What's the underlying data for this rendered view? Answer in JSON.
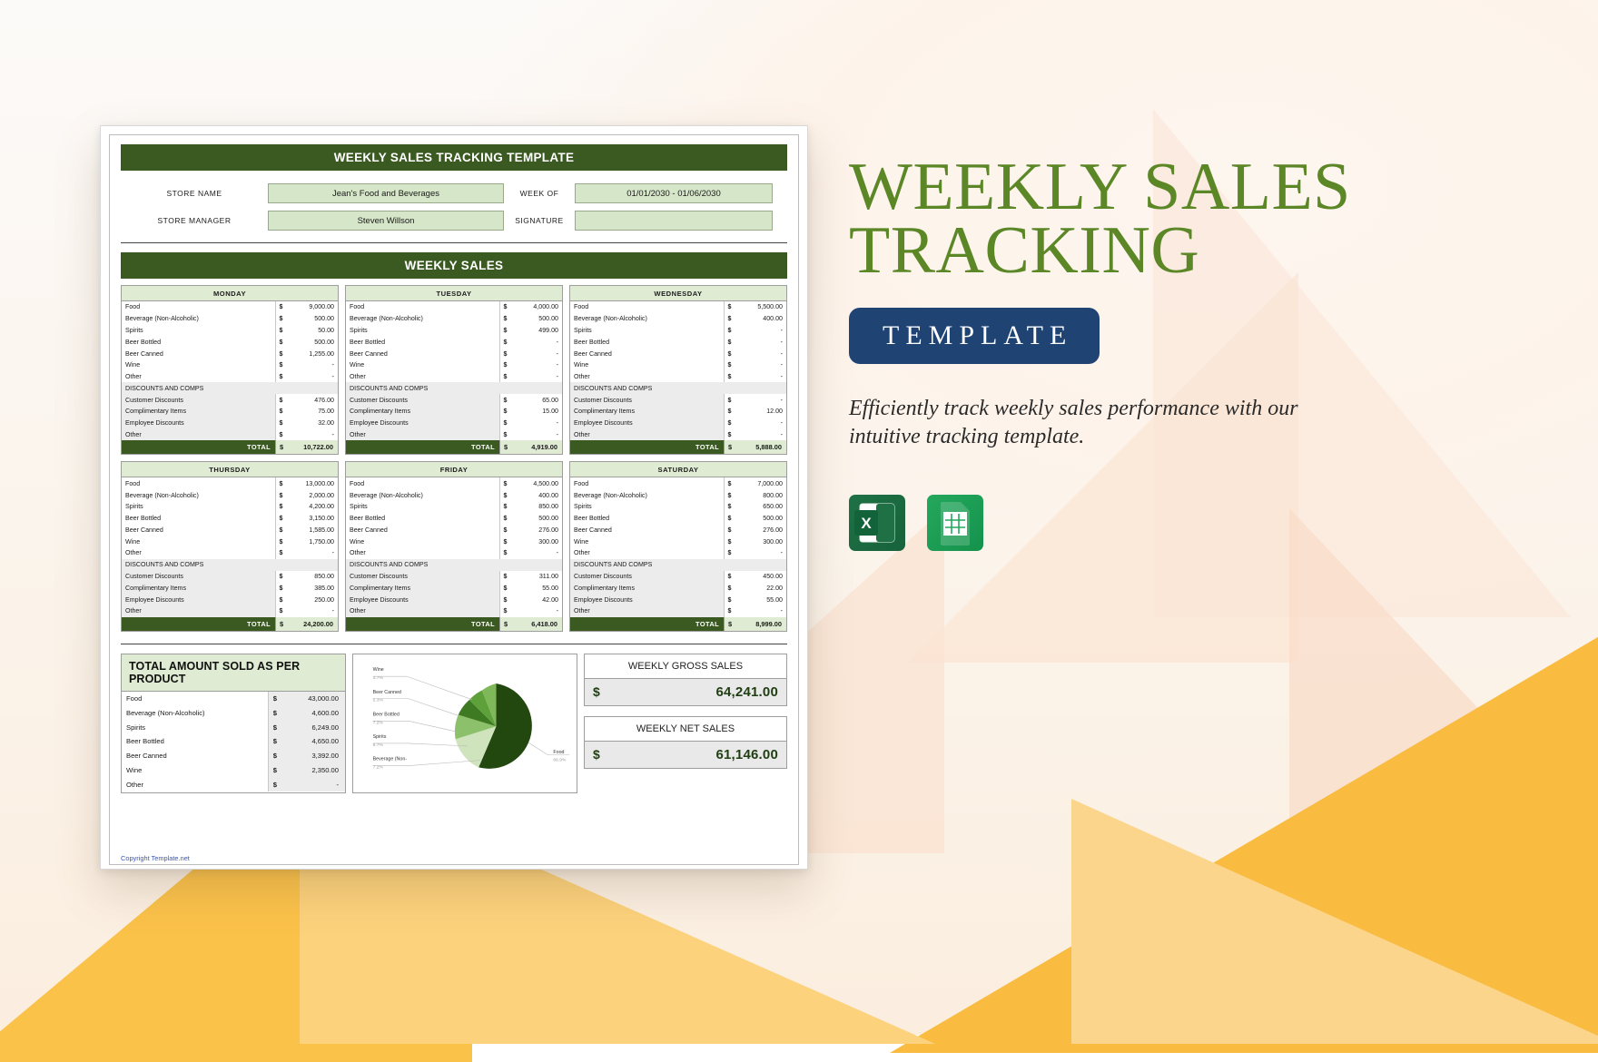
{
  "document": {
    "title": "WEEKLY SALES TRACKING TEMPLATE",
    "section_title": "WEEKLY SALES",
    "copyright": "Copyright Template.net"
  },
  "meta": {
    "store_name_label": "STORE  NAME",
    "store_name_value": "Jean's Food and Beverages",
    "week_of_label": "WEEK OF",
    "week_of_value": "01/01/2030 - 01/06/2030",
    "store_manager_label": "STORE MANAGER",
    "store_manager_value": "Steven Willson",
    "signature_label": "SIGNATURE",
    "signature_value": ""
  },
  "labels": {
    "currency": "$",
    "total": "TOTAL",
    "discounts_header": "DISCOUNTS AND COMPS",
    "products": [
      "Food",
      "Beverage (Non-Alcoholic)",
      "Spirits",
      "Beer Bottled",
      "Beer Canned",
      "Wine",
      "Other"
    ],
    "discount_rows": [
      "Customer Discounts",
      "Complimentary Items",
      "Employee Discounts",
      "Other"
    ]
  },
  "days": [
    {
      "name": "MONDAY",
      "sales": [
        "9,000.00",
        "500.00",
        "50.00",
        "500.00",
        "1,255.00",
        "-",
        "-"
      ],
      "discounts": [
        "476.00",
        "75.00",
        "32.00",
        "-"
      ],
      "total": "10,722.00"
    },
    {
      "name": "TUESDAY",
      "sales": [
        "4,000.00",
        "500.00",
        "499.00",
        "-",
        "-",
        "-",
        "-"
      ],
      "discounts": [
        "65.00",
        "15.00",
        "-",
        "-"
      ],
      "total": "4,919.00"
    },
    {
      "name": "WEDNESDAY",
      "sales": [
        "5,500.00",
        "400.00",
        "-",
        "-",
        "-",
        "-",
        "-"
      ],
      "discounts": [
        "-",
        "12.00",
        "-",
        "-"
      ],
      "total": "5,888.00"
    },
    {
      "name": "THURSDAY",
      "sales": [
        "13,000.00",
        "2,000.00",
        "4,200.00",
        "3,150.00",
        "1,585.00",
        "1,750.00",
        "-"
      ],
      "discounts": [
        "850.00",
        "385.00",
        "250.00",
        "-"
      ],
      "total": "24,200.00"
    },
    {
      "name": "FRIDAY",
      "sales": [
        "4,500.00",
        "400.00",
        "850.00",
        "500.00",
        "276.00",
        "300.00",
        "-"
      ],
      "discounts": [
        "311.00",
        "55.00",
        "42.00",
        "-"
      ],
      "total": "6,418.00"
    },
    {
      "name": "SATURDAY",
      "sales": [
        "7,000.00",
        "800.00",
        "650.00",
        "500.00",
        "276.00",
        "300.00",
        "-"
      ],
      "discounts": [
        "450.00",
        "22.00",
        "55.00",
        "-"
      ],
      "total": "8,999.00"
    }
  ],
  "product_totals": {
    "header": "TOTAL AMOUNT SOLD AS PER PRODUCT",
    "rows": [
      {
        "label": "Food",
        "amount": "43,000.00"
      },
      {
        "label": "Beverage (Non-Alcoholic)",
        "amount": "4,600.00"
      },
      {
        "label": "Spirits",
        "amount": "6,249.00"
      },
      {
        "label": "Beer Bottled",
        "amount": "4,650.00"
      },
      {
        "label": "Beer Canned",
        "amount": "3,392.00"
      },
      {
        "label": "Wine",
        "amount": "2,350.00"
      },
      {
        "label": "Other",
        "amount": "-"
      }
    ]
  },
  "summary": {
    "gross_label": "WEEKLY GROSS SALES",
    "gross_currency": "$",
    "gross_amount": "64,241.00",
    "net_label": "WEEKLY NET SALES",
    "net_currency": "$",
    "net_amount": "61,146.00"
  },
  "chart_data": {
    "type": "pie",
    "title": "",
    "legend_position": "callout-labels",
    "categories": [
      "Food",
      "Beverage (Non-Alcoholic)",
      "Spirits",
      "Beer Bottled",
      "Beer Canned",
      "Wine",
      "Other"
    ],
    "values": [
      43000,
      4600,
      6249,
      4650,
      3392,
      2350,
      0
    ],
    "percent_labels": [
      "66.9%",
      "7.2%",
      "9.7%",
      "7.2%",
      "5.3%",
      "3.7%",
      ""
    ],
    "slice_colors": [
      "#22480f",
      "#cfe3bd",
      "#8cc06a",
      "#3d7a22",
      "#5ea13a",
      "#7fb859",
      "#e2eedb"
    ],
    "callouts": [
      {
        "label": "Wine",
        "value": "3.7%"
      },
      {
        "label": "Beer Canned",
        "value": "5.3%"
      },
      {
        "label": "Beer Bottled",
        "value": "7.2%"
      },
      {
        "label": "Spirits",
        "value": "9.7%"
      },
      {
        "label": "Beverage (Non-",
        "value": "7.2%"
      }
    ],
    "right_callout": {
      "label": "Food",
      "value": "66.9%"
    }
  },
  "promo": {
    "heading_line1": "WEEKLY SALES",
    "heading_line2": "TRACKING",
    "badge": "TEMPLATE",
    "tagline": "Efficiently track weekly sales performance with our intuitive tracking template.",
    "file_excel": "excel-icon",
    "file_sheets": "google-sheets-icon",
    "accent_green": "#5c8727",
    "accent_navy": "#1f4373"
  }
}
